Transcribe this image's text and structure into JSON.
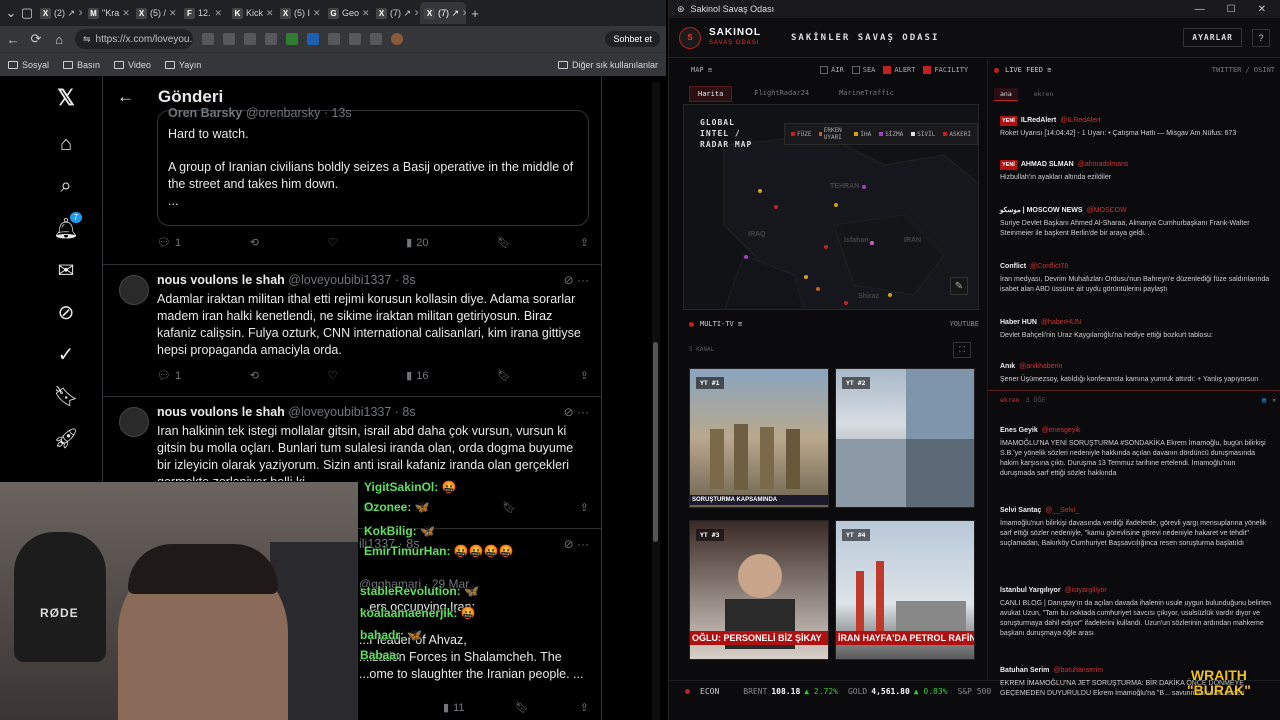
{
  "browser": {
    "tabs": [
      {
        "icon": "X",
        "title": "(2) ↗"
      },
      {
        "icon": "M",
        "title": "\"Kra"
      },
      {
        "icon": "X",
        "title": "(5) /"
      },
      {
        "icon": "F",
        "title": "12."
      },
      {
        "icon": "K",
        "title": "Kick"
      },
      {
        "icon": "X",
        "title": "(5) I"
      },
      {
        "icon": "G",
        "title": "Geo"
      },
      {
        "icon": "X",
        "title": "(7) ↗"
      },
      {
        "icon": "X",
        "title": "(7) ↗"
      }
    ],
    "url": "https://x.com/loveyou...",
    "chat_button": "Sohbet et",
    "bookmarks": [
      "Sosyal",
      "Basın",
      "Video",
      "Yayın"
    ],
    "bookmarks_right": "Diğer sık kullanılanlar"
  },
  "x": {
    "header_title": "Gönderi",
    "notification_count": "7",
    "quote": {
      "author": "Oren Barsky",
      "handle": "@orenbarsky · 13s",
      "text1": "Hard to watch.",
      "text2": "A group of Iranian civilians boldly seizes a Basij operative in the middle of the street and takes him down.",
      "ellipsis": "..."
    },
    "post0_actions": {
      "replies": "1",
      "views": "20"
    },
    "post1": {
      "name": "nous voulons le shah",
      "handle": "@loveyoubibi1337 · 8s",
      "text": "Adamlar iraktan militan ithal etti rejimi korusun kollasin diye. Adama sorarlar madem iran halki kenetlendi, ne sikime iraktan militan getiriyosun. Biraz kafaniz calişsin. Fulya ozturk, CNN international calisanlari, kim irana gittiyse hepsi propaganda amaciyla orda.",
      "replies": "1",
      "views": "16"
    },
    "post2": {
      "name": "nous voulons le shah",
      "handle": "@loveyoubibi1337 · 8s",
      "text": "Iran halkinin tek istegi mollalar gitsin, israil abd daha çok vursun, vursun ki gitsin bu molla oçları. Bunlari tum sulalesi iranda olan, orda dogma buyume bir izleyicin olarak yaziyorum. Sizin anti israil kafaniz iranda olan gerçekleri gormekte zorlaniyor belli ki.",
      "views": "31"
    },
    "post3": {
      "handle": "ili1337 · 8s",
      "sub": "@gghamari · 29 Mar",
      "text1": "...ers occupying Iran:",
      "text2": "...r leader of Ahvaz,",
      "text3": "...ization Forces in Shalamcheh. The",
      "text4": "...ome to slaughter the Iranian people. ...",
      "views": "11"
    }
  },
  "chat": [
    {
      "user": "YigitSakinOl:",
      "msg": "🤬"
    },
    {
      "user": "Ozonee:",
      "msg": "🦋"
    },
    {
      "user": "KokBilig:",
      "msg": "🦋"
    },
    {
      "user": "EmirTimurHan:",
      "msg": "🤬🤬🤬🤬"
    },
    {
      "user": "stableRevolution:",
      "msg": "🦋"
    },
    {
      "user": "koalaamaenerjik:",
      "msg": "🤬"
    },
    {
      "user": "bahadr:",
      "msg": "🦋"
    },
    {
      "user": "Babaa:",
      "msg": ""
    }
  ],
  "webcam": {
    "mic_brand": "RØDE"
  },
  "app": {
    "window_title": "Sakinol Savaş Odası",
    "brand_top": "SAKINOL",
    "brand_bottom": "SAVAŞ ODASI",
    "room_title": "SAKİNLER SAVAŞ ODASI",
    "settings": "AYARLAR",
    "help": "?",
    "map_label": "MAP ≡",
    "filters": [
      {
        "label": "AIR",
        "on": false
      },
      {
        "label": "SEA",
        "on": false
      },
      {
        "label": "ALERT",
        "on": true
      },
      {
        "label": "FACILITY",
        "on": true
      }
    ],
    "map_tabs": [
      "Harita",
      "FlightRadar24",
      "MarineTraffic"
    ],
    "map_title": "GLOBAL INTEL / RADAR MAP",
    "legend": [
      "FÜZE",
      "ERKEN UYARI",
      "İHA",
      "SİZMA",
      "SİVİL",
      "ASKERİ"
    ],
    "map_names": [
      "TEHRAN",
      "IRAQ",
      "IRAN",
      "Isfahan",
      "Shiraz"
    ],
    "multitv": "MULTI-TV ≡",
    "youtube": "YOUTUBE",
    "channels": "5 KANAL",
    "videos": [
      {
        "label": "YT #1",
        "caption": "SORUŞTURMA KAPSAMINDA"
      },
      {
        "label": "YT #2",
        "caption": ""
      },
      {
        "label": "YT #3",
        "caption": "OĞLU: PERSONELİ BİZ ŞİKAY"
      },
      {
        "label": "YT #4",
        "caption": "İRAN HAYFA'DA PETROL RAFİNER"
      }
    ],
    "econ": {
      "label": "ECON",
      "brent_label": "BRENT",
      "brent": "108.18",
      "brent_chg": "▲ 2.72%",
      "gold_label": "GOLD",
      "gold": "4,561.80",
      "gold_chg": "▲ 0.83%",
      "sp_label": "S&P 500"
    },
    "live_feed": {
      "title": "LIVE FEED ≡",
      "source": "TWITTER / OSINT",
      "tabs": [
        "ana",
        "ekren"
      ],
      "posts": [
        {
          "tag": "YENİ",
          "name": "ILRedAlert",
          "handle": "@ILRedAlert",
          "text": "Roket Uyarısı [14:04:42] - 1 Uyarı: • Çatışma Hattı — Misgav Am Nüfus: 673"
        },
        {
          "tag": "YENİ",
          "name": "AHMAD SLMAN",
          "handle": "@ahmadslmans",
          "text": "Hizbullah'ın ayakları altında ezildiler"
        },
        {
          "tag": "",
          "name": "موسكو | MOSCOW NEWS",
          "handle": "@MOSCOW",
          "text": "Suriye Devlet Başkanı Ahmed Al-Sharaa, Almanya Cumhurbaşkanı Frank-Walter Steinmeier ile başkent Berlin'de bir araya geldi. ."
        },
        {
          "tag": "",
          "name": "Conflict",
          "handle": "@Conflict78",
          "text": "İran medyası, Devrim Muhafızları Ordusu'nun Bahreyn'e düzenlediği füze saldırılarında isabet alan ABD üssüne ait uydu görüntülerini paylaştı"
        },
        {
          "tag": "",
          "name": "Haber HUN",
          "handle": "@haberHUN",
          "text": "Devlet Bahçeli'nin Uraz Kaygılaroğlu'na hediye ettiği bozkurt tablosu:"
        },
        {
          "tag": "",
          "name": "Anık",
          "handle": "@anikhaberin",
          "text": "Şener Üşümezsoy, katıldığı konferansta kamına yumruk attırdı: + Yanlış yapıyorsun"
        }
      ],
      "ekren_title": "ekren",
      "ekren_sub": "3 ÖĞE",
      "ekren_posts": [
        {
          "name": "Enes Geyik",
          "handle": "@enesgeyik",
          "text": "İMAMOĞLU'NA YENİ SORUŞTURMA #SONDAKİKA Ekrem İmamoğlu, bugün bilirkişi S.B.'ye yönelik sözleri nedeniyle hakkında açılan davanın dördüncü duruşmasında hakim karşısına çıktı. Duruşma 13 Temmuz tarihine ertelendi. İmamoğlu'nun duruşmada sarf ettiği sözler hakkında"
        },
        {
          "name": "Selvi Santaç",
          "handle": "@__Selvi_",
          "text": "İmamoğlu'nun bilirkişi davasında verdiği ifadelerde, görevli yargı mensuplarına yönelik sarf ettiği sözler nedeniyle, \"kamu görevlisine görevi nedeniyle hakaret ve tehdit\" suçlamadan, Bakırköy Cumhuriyet Başsavcılığınca resen soruşturma başlatıldı"
        },
        {
          "name": "İstanbul Yargılıyor",
          "handle": "@istyargiliyor",
          "text": "CANLI BLOG | Danıştay'ın da açılan davada ihalenin usule uygun bulunduğunu belirten avukat Uzun, \"Tam bu noktada cumhuriyet savcısı çıkıyor, usulsüzlük vardır diyor ve soruşturmaya dahil ediyor\" ifadelerini kullandı. Uzun'un sözlerinin ardından mahkeme başkanı duruşmaya öğle arası"
        },
        {
          "name": "Batuhan Serim",
          "handle": "@batuhanserim",
          "text": "EKREM İMAMOĞLU'NA JET SORUŞTURMA: BİR DAKİKA ÖNCE DÖNMEYE GEÇEMEDEN DUYURULDU Ekrem İmamoğlu'na \"B... savunmasındaki sözleri nedeniyle yeni bir soruşturma..."
        }
      ]
    },
    "watermark_top": "WRAITH",
    "watermark_bottom": "\"BURAK\""
  }
}
